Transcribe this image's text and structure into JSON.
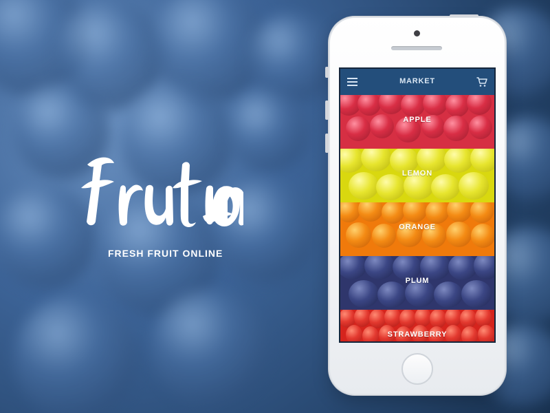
{
  "brand": {
    "logo": "frutino",
    "tagline": "FRESH FRUIT ONLINE"
  },
  "app": {
    "title": "MARKET",
    "menu_icon": "menu-icon",
    "cart_icon": "cart-icon"
  },
  "categories": [
    {
      "label": "APPLE"
    },
    {
      "label": "LEMON"
    },
    {
      "label": "ORANGE"
    },
    {
      "label": "PLUM"
    },
    {
      "label": "STRAWBERRY"
    }
  ],
  "colors": {
    "background": "#3d6498",
    "nav": "#234e7b",
    "apple": "#d62f43",
    "lemon": "#d9d80f",
    "orange": "#f07a0b",
    "plum": "#2f366c",
    "strawberry": "#d5241d",
    "text": "#ffffff"
  }
}
